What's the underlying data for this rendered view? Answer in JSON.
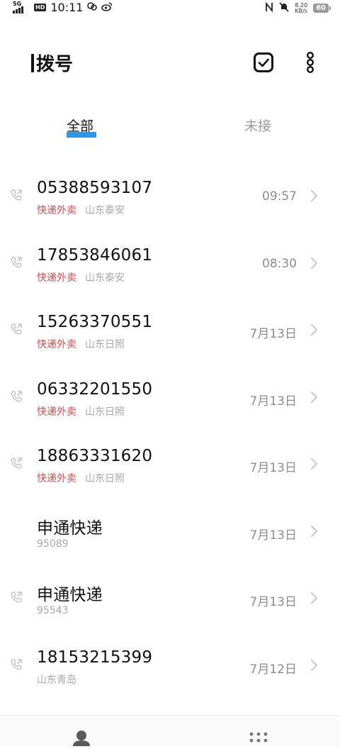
{
  "status_bar": {
    "network": "5G",
    "hd": "HD",
    "time": "10:11",
    "speed_value": "8.20",
    "speed_unit": "KB/s",
    "battery": "60"
  },
  "header": {
    "title": "拨号"
  },
  "tabs": [
    {
      "label": "全部",
      "active": true
    },
    {
      "label": "未接",
      "active": false
    }
  ],
  "calls": [
    {
      "number": "05388593107",
      "tag": "快递外卖",
      "location": "山东泰安",
      "time": "09:57",
      "show_call_icon": true
    },
    {
      "number": "17853846061",
      "tag": "快递外卖",
      "location": "山东泰安",
      "time": "08:30",
      "show_call_icon": true
    },
    {
      "number": "15263370551",
      "tag": "快递外卖",
      "location": "山东日照",
      "time": "7月13日",
      "show_call_icon": true
    },
    {
      "number": "06332201550",
      "tag": "快递外卖",
      "location": "山东日照",
      "time": "7月13日",
      "show_call_icon": true
    },
    {
      "number": "18863331620",
      "tag": "快递外卖",
      "location": "山东日照",
      "time": "7月13日",
      "show_call_icon": true
    },
    {
      "number": "申通快递",
      "tag": "",
      "location": "95089",
      "time": "7月13日",
      "show_call_icon": false
    },
    {
      "number": "申通快递",
      "tag": "",
      "location": "95543",
      "time": "7月13日",
      "show_call_icon": true
    },
    {
      "number": "18153215399",
      "tag": "",
      "location": "山东青岛",
      "time": "7月12日",
      "show_call_icon": true
    }
  ],
  "colors": {
    "accent": "#2f95e6",
    "tag_red": "#d94b4b",
    "muted": "#a8a8a8"
  },
  "icons": {
    "select": "checkbox-icon",
    "more": "more-vertical-icon",
    "row_call": "outgoing-call-icon",
    "row_detail": "chevron-right-icon",
    "nav_contacts": "contacts-icon",
    "nav_dialpad": "dialpad-icon"
  }
}
